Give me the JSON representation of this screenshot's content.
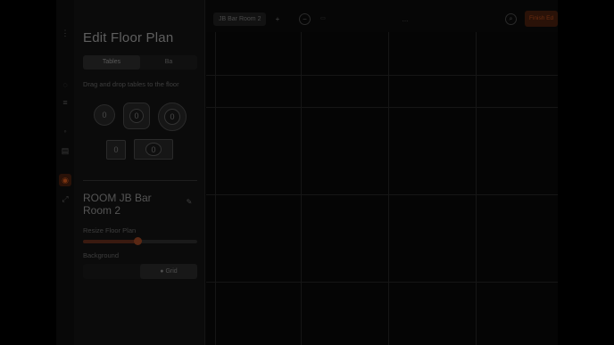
{
  "panel": {
    "title": "Edit Floor Plan",
    "tabs": [
      {
        "label": "Tables",
        "active": true
      },
      {
        "label": "Ba",
        "active": false
      }
    ],
    "hint": "Drag and drop tables to the floor",
    "tables": [
      {
        "label": "0",
        "shape": "round"
      },
      {
        "label": "0",
        "shape": "rounded-square"
      },
      {
        "label": "0",
        "shape": "round-large"
      },
      {
        "label": "0",
        "shape": "square"
      },
      {
        "label": "0",
        "shape": "rectangle"
      }
    ],
    "room_name": "ROOM JB Bar Room 2",
    "resize_label": "Resize Floor Plan",
    "resize_value_percent": 48,
    "background_label": "Background",
    "background_options": [
      {
        "label": "",
        "active": false
      },
      {
        "label": "Grid",
        "active": true
      }
    ]
  },
  "topbar": {
    "room_tab": "JB Bar Room 2",
    "add_label": "+",
    "minus_label": "−",
    "zoom_label": "zoom",
    "mid_label": "...",
    "finish_label": "Finish Ed"
  },
  "colors": {
    "accent": "#c2571f",
    "background": "#0b0b0b"
  },
  "icons": {
    "rail": [
      "menu-icon",
      "table-icon",
      "list-icon",
      "settings-icon",
      "floor-plan-icon",
      "link-icon"
    ]
  }
}
